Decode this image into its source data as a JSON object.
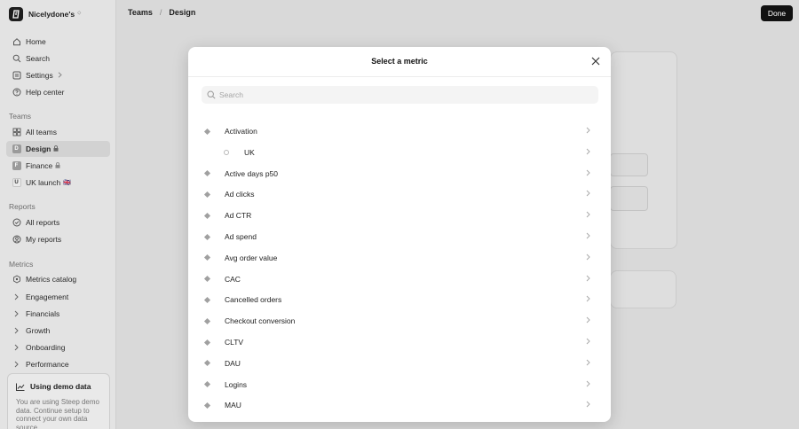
{
  "workspace": {
    "name": "Nicelydone's"
  },
  "sidebar": {
    "nav": [
      {
        "label": "Home"
      },
      {
        "label": "Search"
      },
      {
        "label": "Settings"
      },
      {
        "label": "Help center"
      }
    ],
    "teams_heading": "Teams",
    "teams": [
      {
        "label": "All teams"
      },
      {
        "label": "Design",
        "initial": "D"
      },
      {
        "label": "Finance",
        "initial": "F"
      },
      {
        "label": "UK launch",
        "initial": "U",
        "emoji": "🇬🇧"
      }
    ],
    "reports_heading": "Reports",
    "reports": [
      {
        "label": "All reports"
      },
      {
        "label": "My reports"
      }
    ],
    "metrics_heading": "Metrics",
    "metrics": [
      {
        "label": "Metrics catalog"
      },
      {
        "label": "Engagement"
      },
      {
        "label": "Financials"
      },
      {
        "label": "Growth"
      },
      {
        "label": "Onboarding"
      },
      {
        "label": "Performance"
      }
    ],
    "demo": {
      "title": "Using demo data",
      "text": "You are using Steep demo data. Continue setup to connect your own data source."
    }
  },
  "header": {
    "breadcrumb": [
      "Teams",
      "Design"
    ],
    "done_label": "Done"
  },
  "modal": {
    "title": "Select a metric",
    "search_placeholder": "Search",
    "items": [
      {
        "label": "Activation"
      },
      {
        "label": "UK"
      },
      {
        "label": "Active days p50"
      },
      {
        "label": "Ad clicks"
      },
      {
        "label": "Ad CTR"
      },
      {
        "label": "Ad spend"
      },
      {
        "label": "Avg order value"
      },
      {
        "label": "CAC"
      },
      {
        "label": "Cancelled orders"
      },
      {
        "label": "Checkout conversion"
      },
      {
        "label": "CLTV"
      },
      {
        "label": "DAU"
      },
      {
        "label": "Logins"
      },
      {
        "label": "MAU"
      }
    ]
  },
  "colors": {
    "accent": "#111111",
    "sidebar_bg": "#e3e3e3",
    "selected_bg": "#d2d2d2"
  }
}
